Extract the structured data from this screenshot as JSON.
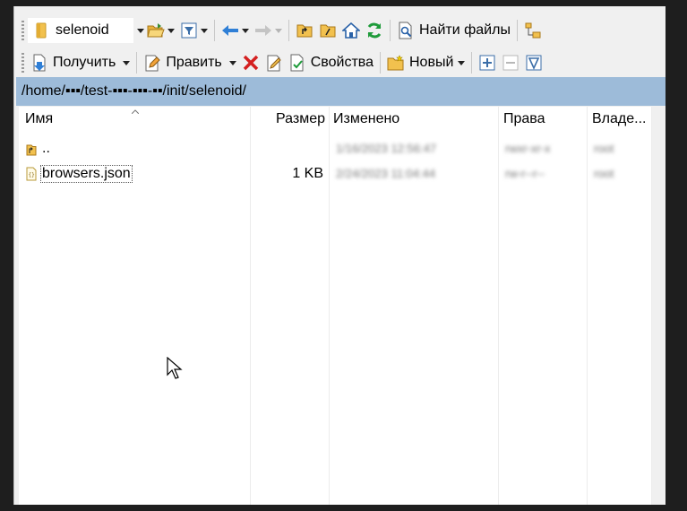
{
  "toolbar1": {
    "location": "selenoid",
    "find_files": "Найти файлы"
  },
  "toolbar2": {
    "download": "Получить",
    "edit": "Править",
    "properties": "Свойства",
    "new": "Новый"
  },
  "path": "/home/▪▪▪/test-▪▪▪-▪▪▪-▪▪/init/selenoid/",
  "columns": {
    "name": "Имя",
    "size": "Размер",
    "changed": "Изменено",
    "rights": "Права",
    "owner": "Владе..."
  },
  "files": [
    {
      "name": "..",
      "size": "",
      "changed": "1/16/2023 12:56:47",
      "rights": "rwxr-xr-x",
      "owner": "root"
    },
    {
      "name": "browsers.json",
      "size": "1 KB",
      "changed": "2/24/2023 11:04:44",
      "rights": "rw-r--r--",
      "owner": "root"
    }
  ],
  "icons": [
    "folder-icon",
    "open-folder-icon",
    "filter-icon",
    "back-arrow-icon",
    "forward-arrow-icon",
    "parent-dir-icon",
    "root-dir-icon",
    "home-icon",
    "refresh-icon",
    "find-files-icon",
    "tree-icon",
    "download-icon",
    "edit-icon",
    "delete-icon",
    "rename-icon",
    "properties-icon",
    "new-icon",
    "select-plus-icon",
    "select-minus-icon",
    "filter-v-icon",
    "up-dir-icon",
    "json-file-icon",
    "mouse-cursor-icon"
  ],
  "colors": {
    "path_bar": "#9dbbd9",
    "delete_red": "#d42020",
    "refresh_green": "#1e9b3a",
    "folder_yellow": "#f2c14e"
  }
}
